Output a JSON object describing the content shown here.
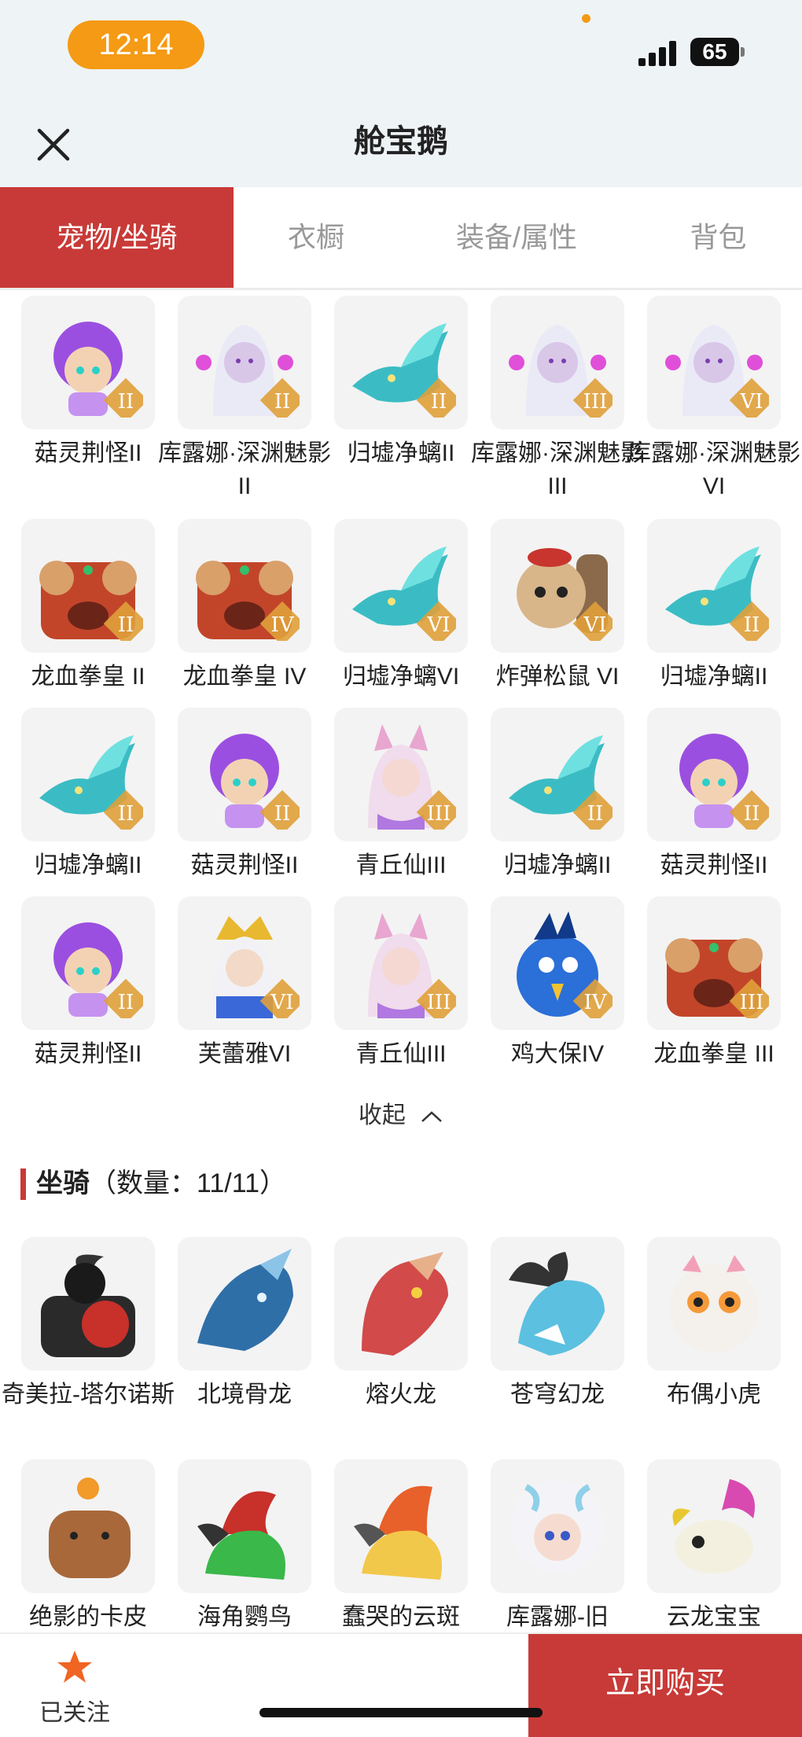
{
  "status": {
    "time": "12:14",
    "battery": "65"
  },
  "nav": {
    "title": "舱宝鹅"
  },
  "tabs": [
    {
      "label": "宠物/坐骑",
      "active": true
    },
    {
      "label": "衣橱",
      "active": false
    },
    {
      "label": "装备/属性",
      "active": false
    },
    {
      "label": "背包",
      "active": false
    }
  ],
  "pets": [
    {
      "name": "菇灵荆怪II",
      "icon": "purple-hair-goblin",
      "level": "II"
    },
    {
      "name": "库露娜·深渊魅影II",
      "icon": "white-hair-girl",
      "level": "II"
    },
    {
      "name": "归墟净螭II",
      "icon": "teal-dragon",
      "level": "II"
    },
    {
      "name": "库露娜·深渊魅影III",
      "icon": "white-hair-girl",
      "level": "III"
    },
    {
      "name": "库露娜·深渊魅影VI",
      "icon": "white-hair-girl",
      "level": "VI"
    },
    {
      "name": "龙血拳皇 II",
      "icon": "red-ram-beast",
      "level": "II"
    },
    {
      "name": "龙血拳皇 IV",
      "icon": "red-ram-beast",
      "level": "IV"
    },
    {
      "name": "归墟净螭VI",
      "icon": "teal-dragon",
      "level": "VI"
    },
    {
      "name": "炸弹松鼠 VI",
      "icon": "squirrel",
      "level": "VI"
    },
    {
      "name": "归墟净螭II",
      "icon": "teal-dragon",
      "level": "II"
    },
    {
      "name": "归墟净螭II",
      "icon": "teal-dragon",
      "level": "II"
    },
    {
      "name": "菇灵荆怪II",
      "icon": "purple-hair-goblin",
      "level": "II"
    },
    {
      "name": "青丘仙III",
      "icon": "fox-fairy",
      "level": "III"
    },
    {
      "name": "归墟净螭II",
      "icon": "teal-dragon",
      "level": "II"
    },
    {
      "name": "菇灵荆怪II",
      "icon": "purple-hair-goblin",
      "level": "II"
    },
    {
      "name": "菇灵荆怪II",
      "icon": "purple-hair-goblin",
      "level": "II"
    },
    {
      "name": "芙蕾雅VI",
      "icon": "golden-crown-girl",
      "level": "VI"
    },
    {
      "name": "青丘仙III",
      "icon": "fox-fairy",
      "level": "III"
    },
    {
      "name": "鸡大保IV",
      "icon": "blue-bird",
      "level": "IV"
    },
    {
      "name": "龙血拳皇 III",
      "icon": "red-ram-beast",
      "level": "III"
    }
  ],
  "collapse_label": "收起",
  "mounts_section": {
    "title": "坐骑",
    "count": "（数量：11/11）"
  },
  "mounts": [
    {
      "name": "奇美拉-塔尔诺斯",
      "icon": "black-chimera"
    },
    {
      "name": "北境骨龙",
      "icon": "blue-bone-dragon"
    },
    {
      "name": "熔火龙",
      "icon": "red-fire-dragon"
    },
    {
      "name": "苍穹幻龙",
      "icon": "sky-dragon"
    },
    {
      "name": "布偶小虎",
      "icon": "cloth-tiger"
    },
    {
      "name": "绝影的卡皮",
      "icon": "capybara"
    },
    {
      "name": "海角鹦鸟",
      "icon": "green-parrot"
    },
    {
      "name": "蠢哭的云斑",
      "icon": "yellow-bird"
    },
    {
      "name": "库露娜-旧",
      "icon": "sheep-girl"
    },
    {
      "name": "云龙宝宝",
      "icon": "pink-cloud-dragon"
    }
  ],
  "bottom_bar": {
    "follow_label": "已关注",
    "buy_label": "立即购买"
  },
  "colors": {
    "accent": "#c83a37",
    "status_pill": "#f59a14",
    "header_bg": "#eef3f6"
  }
}
